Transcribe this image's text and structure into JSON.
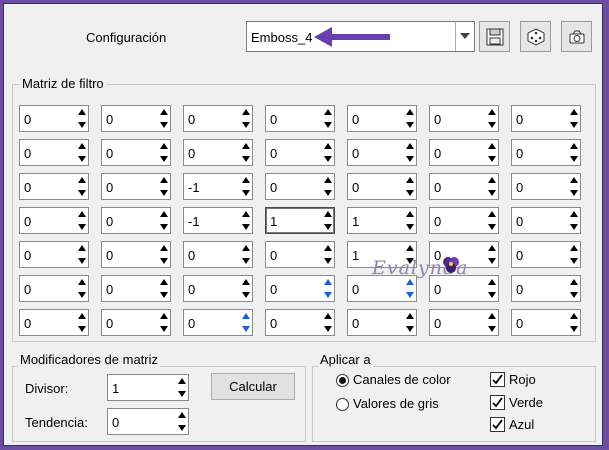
{
  "header": {
    "config_label": "Configuración",
    "preset_value": "Emboss_4"
  },
  "matrix": {
    "title": "Matriz de filtro",
    "rows": [
      [
        "0",
        "0",
        "0",
        "0",
        "0",
        "0",
        "0"
      ],
      [
        "0",
        "0",
        "0",
        "0",
        "0",
        "0",
        "0"
      ],
      [
        "0",
        "0",
        "-1",
        "0",
        "0",
        "0",
        "0"
      ],
      [
        "0",
        "0",
        "-1",
        "1",
        "1",
        "0",
        "0"
      ],
      [
        "0",
        "0",
        "0",
        "0",
        "1",
        "0",
        "0"
      ],
      [
        "0",
        "0",
        "0",
        "0",
        "0",
        "0",
        "0"
      ],
      [
        "0",
        "0",
        "0",
        "0",
        "0",
        "0",
        "0"
      ]
    ]
  },
  "watermark": "Evalynda",
  "modifiers": {
    "title": "Modificadores de matriz",
    "divisor_label": "Divisor:",
    "divisor_value": "1",
    "bias_label": "Tendencia:",
    "bias_value": "0",
    "calc_button": "Calcular"
  },
  "apply": {
    "title": "Aplicar a",
    "radio_color": "Canales de color",
    "radio_gray": "Valores de gris",
    "selected": "color",
    "check_red": "Rojo",
    "check_green": "Verde",
    "check_blue": "Azul"
  },
  "colors": {
    "accent_arrow": "#6a3fb0"
  }
}
